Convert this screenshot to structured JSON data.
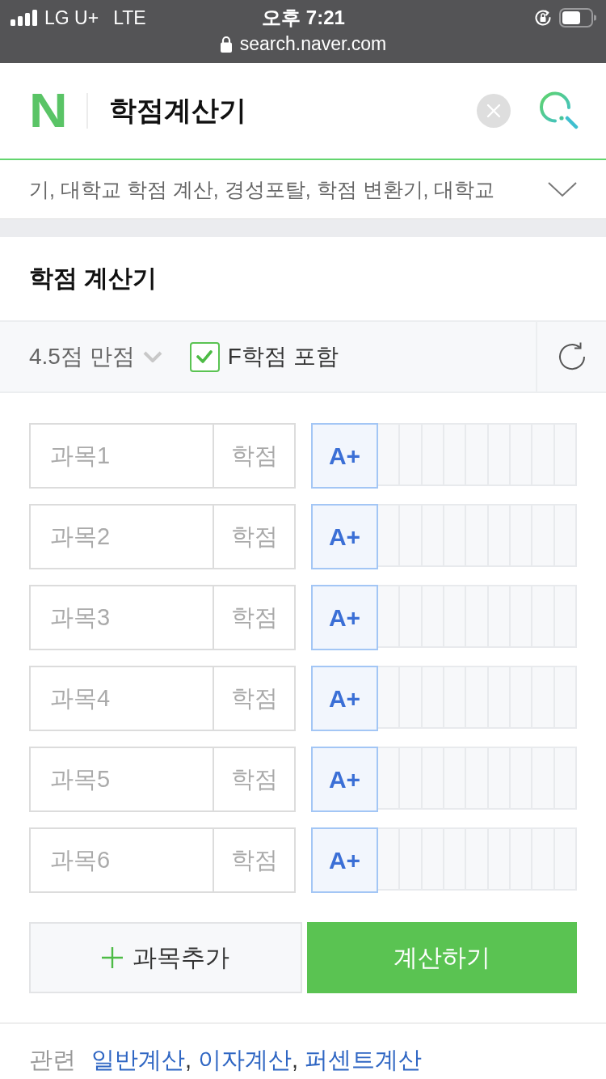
{
  "status_bar": {
    "carrier": "LG U+",
    "network": "LTE",
    "time": "오후 7:21",
    "url": "search.naver.com"
  },
  "header": {
    "logo": "N",
    "query": "학점계산기"
  },
  "suggestions": {
    "text": "기, 대학교 학점 계산, 경성포탈, 학점 변환기, 대학교"
  },
  "calculator": {
    "title": "학점 계산기",
    "scale": "4.5점 만점",
    "include_f": {
      "label": "F학점 포함",
      "checked": true
    },
    "rows": [
      {
        "subject": {
          "placeholder": "과목1"
        },
        "credit": {
          "placeholder": "학점"
        },
        "grades": [
          {
            "label": "A+",
            "selected": true
          },
          {
            "selected": false
          },
          {
            "selected": false
          },
          {
            "selected": false
          },
          {
            "selected": false
          },
          {
            "selected": false
          },
          {
            "selected": false
          },
          {
            "selected": false
          },
          {
            "selected": false
          },
          {
            "selected": false
          }
        ]
      },
      {
        "subject": {
          "placeholder": "과목2"
        },
        "credit": {
          "placeholder": "학점"
        },
        "grades": [
          {
            "label": "A+",
            "selected": true
          },
          {
            "selected": false
          },
          {
            "selected": false
          },
          {
            "selected": false
          },
          {
            "selected": false
          },
          {
            "selected": false
          },
          {
            "selected": false
          },
          {
            "selected": false
          },
          {
            "selected": false
          },
          {
            "selected": false
          }
        ]
      },
      {
        "subject": {
          "placeholder": "과목3"
        },
        "credit": {
          "placeholder": "학점"
        },
        "grades": [
          {
            "label": "A+",
            "selected": true
          },
          {
            "selected": false
          },
          {
            "selected": false
          },
          {
            "selected": false
          },
          {
            "selected": false
          },
          {
            "selected": false
          },
          {
            "selected": false
          },
          {
            "selected": false
          },
          {
            "selected": false
          },
          {
            "selected": false
          }
        ]
      },
      {
        "subject": {
          "placeholder": "과목4"
        },
        "credit": {
          "placeholder": "학점"
        },
        "grades": [
          {
            "label": "A+",
            "selected": true
          },
          {
            "selected": false
          },
          {
            "selected": false
          },
          {
            "selected": false
          },
          {
            "selected": false
          },
          {
            "selected": false
          },
          {
            "selected": false
          },
          {
            "selected": false
          },
          {
            "selected": false
          },
          {
            "selected": false
          }
        ]
      },
      {
        "subject": {
          "placeholder": "과목5"
        },
        "credit": {
          "placeholder": "학점"
        },
        "grades": [
          {
            "label": "A+",
            "selected": true
          },
          {
            "selected": false
          },
          {
            "selected": false
          },
          {
            "selected": false
          },
          {
            "selected": false
          },
          {
            "selected": false
          },
          {
            "selected": false
          },
          {
            "selected": false
          },
          {
            "selected": false
          },
          {
            "selected": false
          }
        ]
      },
      {
        "subject": {
          "placeholder": "과목6"
        },
        "credit": {
          "placeholder": "학점"
        },
        "grades": [
          {
            "label": "A+",
            "selected": true
          },
          {
            "selected": false
          },
          {
            "selected": false
          },
          {
            "selected": false
          },
          {
            "selected": false
          },
          {
            "selected": false
          },
          {
            "selected": false
          },
          {
            "selected": false
          },
          {
            "selected": false
          },
          {
            "selected": false
          }
        ]
      }
    ],
    "add_button": "과목추가",
    "calculate_button": "계산하기"
  },
  "related": {
    "label": "관련",
    "separator": ",",
    "links": [
      "일반계산",
      "이자계산",
      "퍼센트계산"
    ]
  }
}
